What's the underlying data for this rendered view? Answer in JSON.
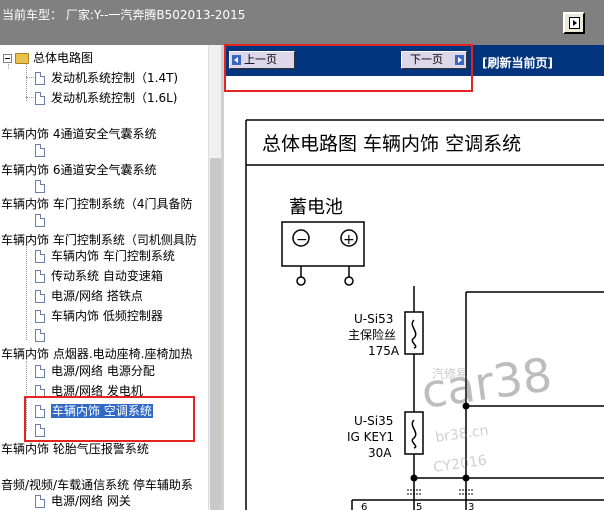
{
  "header": {
    "vehicle_label": "当前车型：  厂家:Y--一汽奔腾B502013-2015"
  },
  "tree": {
    "items": [
      {
        "label": "总体电路图",
        "kind": "folder"
      },
      {
        "label": "发动机系统控制（1.4T)",
        "kind": "page"
      },
      {
        "label": "发动机系统控制（1.6L)",
        "kind": "page"
      },
      {
        "label": "车辆内饰 4通道安全气囊系统",
        "kind": "text"
      },
      {
        "label": "",
        "kind": "page"
      },
      {
        "label": "车辆内饰 6通道安全气囊系统",
        "kind": "text"
      },
      {
        "label": "",
        "kind": "page"
      },
      {
        "label": "车辆内饰 车门控制系统（4门具备防",
        "kind": "text"
      },
      {
        "label": "",
        "kind": "page"
      },
      {
        "label": "车辆内饰 车门控制系统（司机侧具防",
        "kind": "text"
      },
      {
        "label": "车辆内饰 车门控制系统",
        "kind": "page"
      },
      {
        "label": "传动系统 自动变速箱",
        "kind": "page"
      },
      {
        "label": "电源/网络 搭铁点",
        "kind": "page"
      },
      {
        "label": "车辆内饰 低频控制器",
        "kind": "page"
      },
      {
        "label": "",
        "kind": "page"
      },
      {
        "label": "车辆内饰 点烟器.电动座椅.座椅加热",
        "kind": "text"
      },
      {
        "label": "电源/网络 电源分配",
        "kind": "page"
      },
      {
        "label": "电源/网络 发电机",
        "kind": "page"
      },
      {
        "label": "车辆内饰 空调系统",
        "kind": "page",
        "selected": true
      },
      {
        "label": "",
        "kind": "page"
      },
      {
        "label": "车辆内饰 轮胎气压报警系统",
        "kind": "text"
      },
      {
        "label": "音频/视频/车载通信系统 停车辅助系",
        "kind": "text"
      },
      {
        "label": "电源/网络 网关",
        "kind": "page"
      }
    ]
  },
  "nav": {
    "prev_label": "上一页",
    "next_label": "下一页",
    "refresh_label": "[刷新当前页]"
  },
  "diagram": {
    "title": "总体电路图  车辆内饰  空调系统",
    "battery_label": "蓄电池",
    "battery_minus": "−",
    "battery_plus": "+",
    "fuse1_id": "U-Si53",
    "fuse1_name": "主保险丝",
    "fuse1_rating": "175A",
    "fuse2_id": "U-Si35",
    "fuse2_name": "IG KEY1",
    "fuse2_rating": "30A",
    "pin_6": "6",
    "pin_5": "5",
    "pin_3": "3",
    "watermark_main": "car38",
    "watermark_sub1": "br38.cn",
    "watermark_sub2": "CY2016",
    "watermark_cn": "汽修易"
  }
}
